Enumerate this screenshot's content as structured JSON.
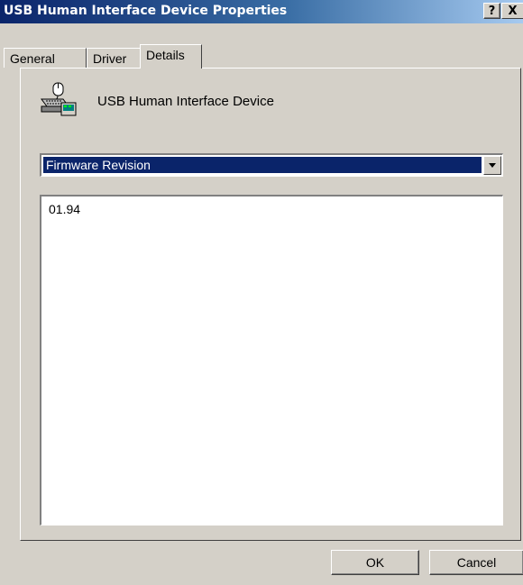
{
  "window": {
    "title": "USB Human Interface Device Properties",
    "help_label": "?",
    "close_label": "X"
  },
  "tabs": [
    {
      "label": "General",
      "selected": false
    },
    {
      "label": "Driver",
      "selected": false
    },
    {
      "label": "Details",
      "selected": true
    }
  ],
  "device": {
    "name": "USB Human Interface Device",
    "icon": "usb-keyboard-mouse-icon"
  },
  "property_select": {
    "selected": "Firmware Revision"
  },
  "values": [
    "01.94"
  ],
  "buttons": {
    "ok": "OK",
    "cancel": "Cancel"
  },
  "colors": {
    "dialog_bg": "#d4d0c8",
    "title_start": "#0a246a",
    "title_end": "#a6caf0",
    "selection": "#0a246a"
  }
}
